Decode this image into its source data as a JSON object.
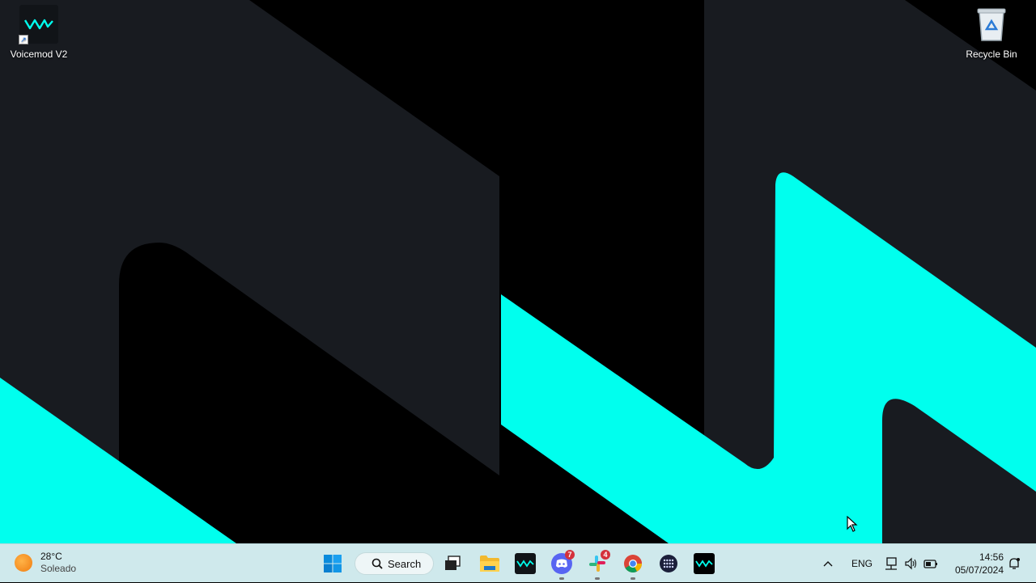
{
  "desktop": {
    "icons": [
      {
        "label": "Voicemod V2",
        "icon": "voicemod-icon"
      },
      {
        "label": "Recycle Bin",
        "icon": "recycle-bin-icon"
      }
    ],
    "wallpaper_colors": {
      "cyan": "#00ffee",
      "dark": "#181b20",
      "black": "#000000"
    }
  },
  "taskbar": {
    "weather": {
      "temp": "28°C",
      "condition": "Soleado",
      "icon": "sun-icon"
    },
    "search_label": "Search",
    "apps": [
      {
        "name": "start",
        "icon": "windows-start-icon"
      },
      {
        "name": "task-view",
        "icon": "task-view-icon"
      },
      {
        "name": "file-explorer",
        "icon": "folder-icon"
      },
      {
        "name": "voicemod",
        "icon": "voicemod-icon"
      },
      {
        "name": "discord",
        "icon": "discord-icon",
        "badge": "7"
      },
      {
        "name": "slack",
        "icon": "slack-icon",
        "badge": "4"
      },
      {
        "name": "chrome",
        "icon": "chrome-icon"
      },
      {
        "name": "keypad-app",
        "icon": "grid-dots-icon"
      },
      {
        "name": "voicemod-2",
        "icon": "voicemod-icon"
      }
    ],
    "tray": {
      "language": "ENG"
    },
    "clock": {
      "time": "14:56",
      "date": "05/07/2024"
    }
  }
}
